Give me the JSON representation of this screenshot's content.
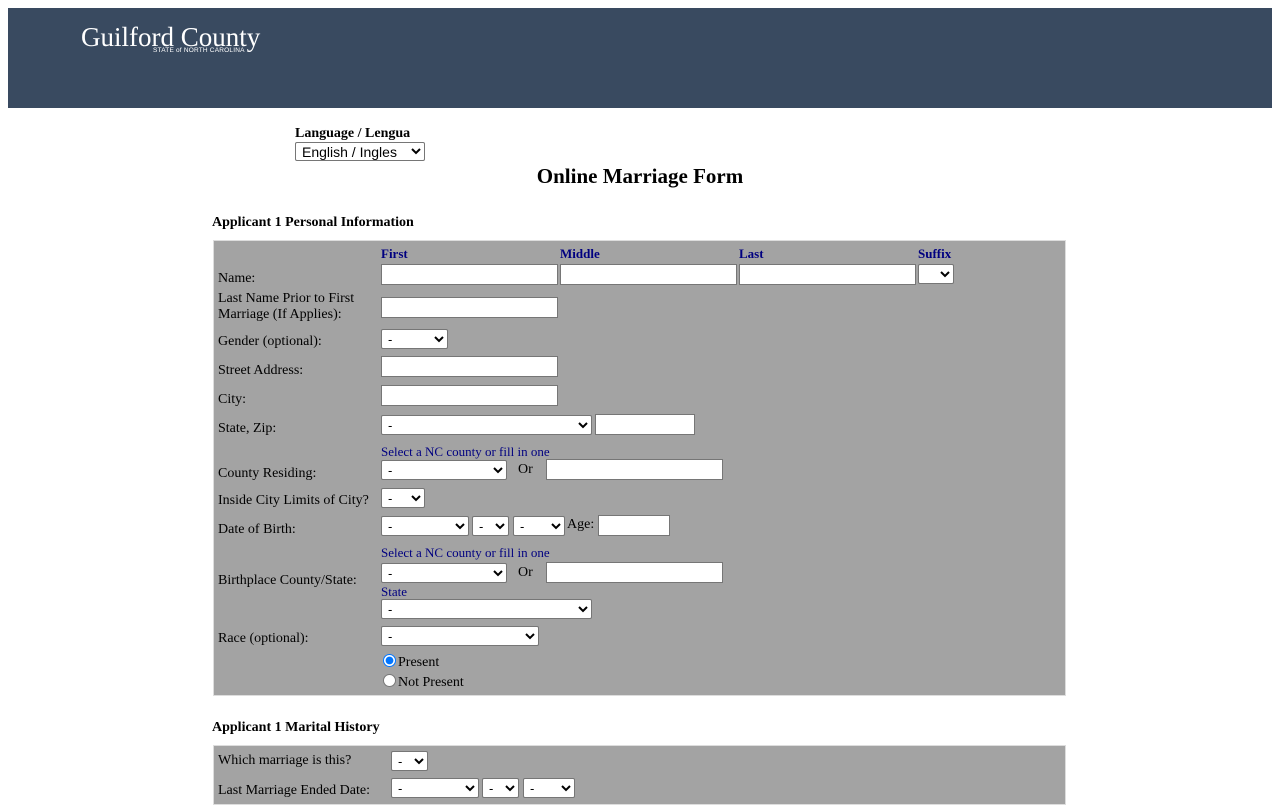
{
  "header": {
    "logo_main": "Guilford County",
    "logo_sub": "STATE of NORTH CAROLINA"
  },
  "language": {
    "label": "Language / Lengua",
    "selected": "English / Ingles"
  },
  "page_title": "Online Marriage Form",
  "applicant1_personal": {
    "section_title": "Applicant 1 Personal Information",
    "columns": {
      "first": "First",
      "middle": "Middle",
      "last": "Last",
      "suffix": "Suffix"
    },
    "name_label": "Name:",
    "prior_name_label_line1": "Last Name Prior to First",
    "prior_name_label_line2": "Marriage (If Applies):",
    "gender_label": "Gender (optional):",
    "gender_value": "-",
    "street_label": "Street Address:",
    "city_label": "City:",
    "state_zip_label": "State, Zip:",
    "state_value": "-",
    "county_hint": "Select a NC county or fill in one",
    "county_label": "County Residing:",
    "county_value": "-",
    "or_text": "Or",
    "inside_city_label": "Inside City Limits of City?",
    "inside_city_value": "-",
    "dob_label": "Date of Birth:",
    "dob_month": "-",
    "dob_day": "-",
    "dob_year": "-",
    "age_label": "Age:",
    "birth_hint": "Select a NC county or fill in one",
    "birthplace_label": "Birthplace County/State:",
    "birth_county_value": "-",
    "state_hint": "State",
    "birth_state_value": "-",
    "race_label": "Race (optional):",
    "race_value": "-",
    "present_label": "Present",
    "not_present_label": "Not Present"
  },
  "applicant1_marital": {
    "section_title": "Applicant 1 Marital History",
    "which_marriage_label": "Which marriage is this?",
    "which_marriage_value": "-",
    "last_ended_label": "Last Marriage Ended Date:",
    "ended_month": "-",
    "ended_day": "-",
    "ended_year": "-"
  }
}
